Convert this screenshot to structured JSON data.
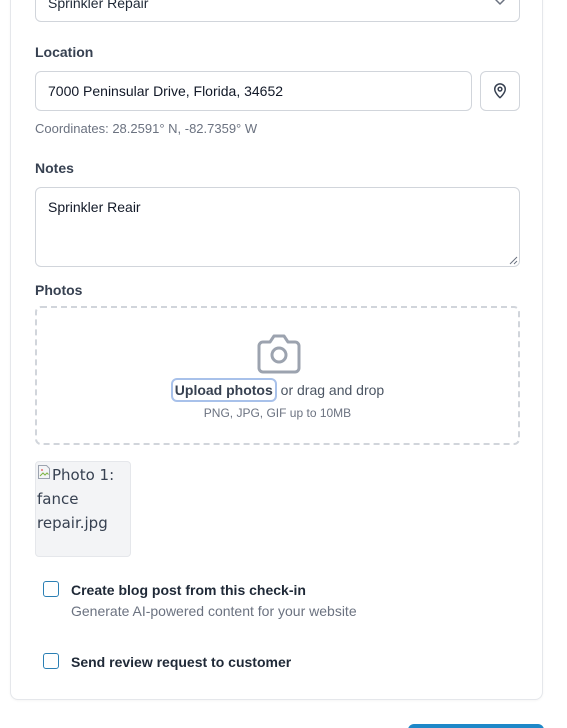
{
  "service_type": {
    "selected": "Sprinkler Repair"
  },
  "location": {
    "label": "Location",
    "value": "7000 Peninsular Drive, Florida, 34652",
    "coordinates": "Coordinates: 28.2591° N, -82.7359° W"
  },
  "notes": {
    "label": "Notes",
    "value": "Sprinkler Reair"
  },
  "photos": {
    "label": "Photos",
    "upload_label": "Upload photos",
    "drag_text": "or drag and drop",
    "hint": "PNG, JPG, GIF up to 10MB",
    "items": [
      {
        "alt": "Photo 1: fance repair.jpg"
      }
    ]
  },
  "options": {
    "blog_post": {
      "title": "Create blog post from this check-in",
      "subtitle": "Generate AI-powered content for your website",
      "checked": false
    },
    "review_request": {
      "title": "Send review request to customer",
      "checked": false
    }
  },
  "icons": {
    "chevron": "chevron-down-icon",
    "location": "map-pin-icon",
    "camera": "camera-icon",
    "broken_image": "broken-image-icon"
  },
  "colors": {
    "accent": "#1e88c8",
    "checkbox_border": "#2b7fb4",
    "focus_ring": "#a8c1ea",
    "border": "#d1d5db",
    "muted_text": "#6b7280"
  }
}
